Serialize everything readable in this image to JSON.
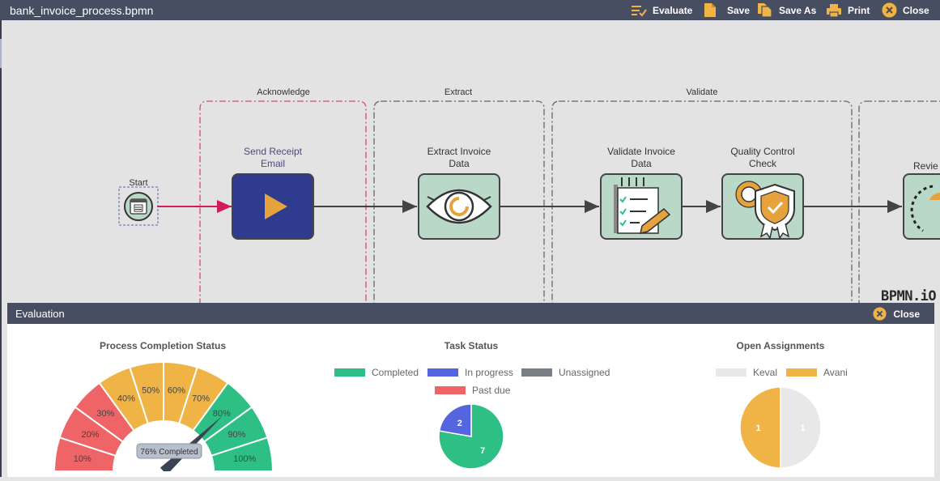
{
  "titlebar": {
    "filename": "bank_invoice_process.bpmn",
    "evaluate_label": "Evaluate",
    "save_label": "Save",
    "save_as_label": "Save As",
    "print_label": "Print",
    "close_label": "Close"
  },
  "diagram": {
    "lanes": [
      {
        "label": "Acknowledge",
        "color": "#d9486a"
      },
      {
        "label": "Extract",
        "color": "#666666"
      },
      {
        "label": "Validate",
        "color": "#666666"
      }
    ],
    "start_label": "Start",
    "tasks": [
      {
        "line1": "Send Receipt",
        "line2": "Email",
        "icon": "play-icon"
      },
      {
        "line1": "Extract Invoice",
        "line2": "Data",
        "icon": "eye-icon"
      },
      {
        "line1": "Validate Invoice",
        "line2": "Data",
        "icon": "checklist-icon"
      },
      {
        "line1": "Quality Control",
        "line2": "Check",
        "icon": "quality-shield-icon"
      },
      {
        "line1": "Revie",
        "line2": "",
        "icon": "review-icon"
      }
    ],
    "watermark": "BPMN.iO"
  },
  "evaluation": {
    "title": "Evaluation",
    "close_label": "Close",
    "completion": {
      "title": "Process Completion Status",
      "segments": [
        "10%",
        "20%",
        "30%",
        "40%",
        "50%",
        "60%",
        "70%",
        "80%",
        "90%",
        "100%"
      ],
      "percent": 76,
      "value_label": "76% Completed"
    },
    "task_status": {
      "title": "Task Status",
      "legend": [
        {
          "name": "Completed",
          "color": "#2ebf85"
        },
        {
          "name": "In progress",
          "color": "#5565e0"
        },
        {
          "name": "Unassigned",
          "color": "#7a7e87"
        },
        {
          "name": "Past due",
          "color": "#ee6467"
        }
      ],
      "chart_data": {
        "type": "pie",
        "categories": [
          "Completed",
          "In progress",
          "Unassigned",
          "Past due"
        ],
        "values": [
          7,
          2,
          0,
          0
        ],
        "labels": [
          "7",
          "2"
        ]
      }
    },
    "open_assignments": {
      "title": "Open Assignments",
      "legend": [
        {
          "name": "Keval",
          "color": "#e8e8e8"
        },
        {
          "name": "Avani",
          "color": "#efb445"
        }
      ],
      "chart_data": {
        "type": "pie",
        "categories": [
          "Keval",
          "Avani"
        ],
        "values": [
          1,
          1
        ],
        "labels": [
          "1",
          "1"
        ]
      }
    }
  }
}
